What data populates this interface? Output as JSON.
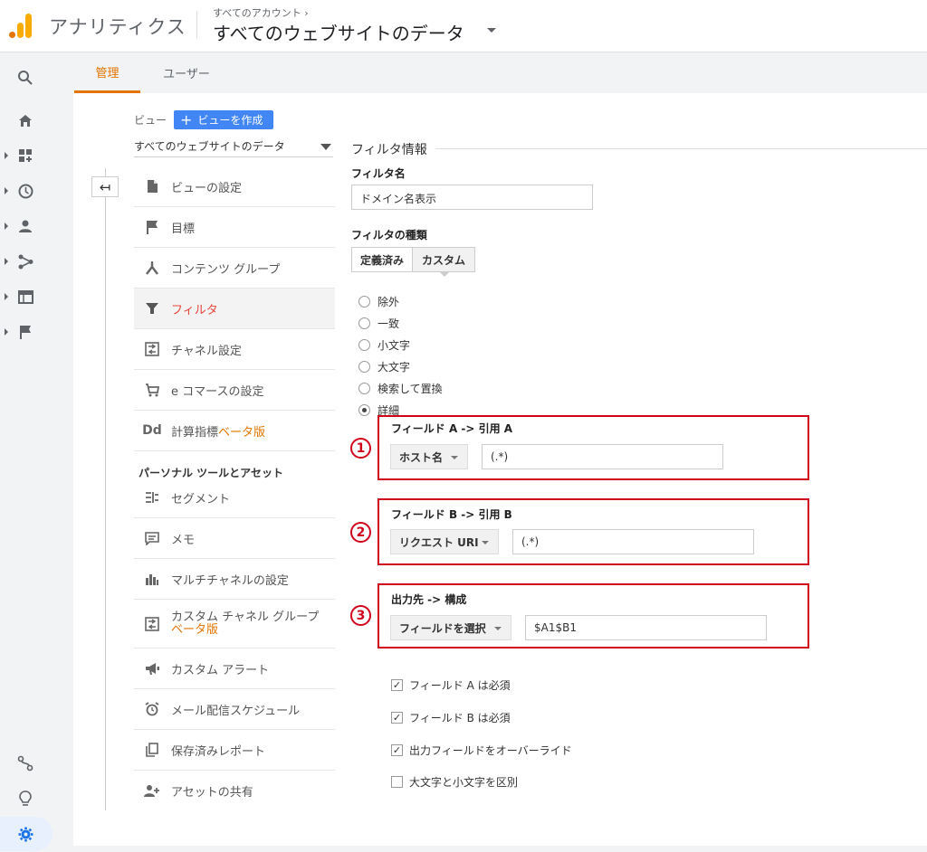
{
  "header": {
    "app_title": "アナリティクス",
    "account_crumb": "すべてのアカウント ›",
    "account_title": "すべてのウェブサイトのデータ"
  },
  "tabs": {
    "admin": "管理",
    "user": "ユーザー"
  },
  "view": {
    "label": "ビュー",
    "create_button": "ビューを作成",
    "selected": "すべてのウェブサイトのデータ"
  },
  "nav": {
    "items": [
      {
        "label": "ビューの設定",
        "icon": "document-icon"
      },
      {
        "label": "目標",
        "icon": "flag-icon"
      },
      {
        "label": "コンテンツ グループ",
        "icon": "content-group-icon"
      },
      {
        "label": "フィルタ",
        "icon": "filter-icon"
      },
      {
        "label": "チャネル設定",
        "icon": "channel-icon"
      },
      {
        "label": "e コマースの設定",
        "icon": "cart-icon"
      },
      {
        "label": "計算指標",
        "beta": "ベータ版",
        "icon_text": "Dd"
      }
    ],
    "section_title": "パーソナル ツールとアセット",
    "personal_items": [
      {
        "label": "セグメント",
        "icon": "segment-icon"
      },
      {
        "label": "メモ",
        "icon": "note-icon"
      },
      {
        "label": "マルチチャネルの設定",
        "icon": "bar-chart-icon"
      },
      {
        "label": "カスタム チャネル グループ",
        "beta": "ベータ版",
        "icon": "channel-icon"
      },
      {
        "label": "カスタム アラート",
        "icon": "megaphone-icon"
      },
      {
        "label": "メール配信スケジュール",
        "icon": "alarm-clock-icon"
      },
      {
        "label": "保存済みレポート",
        "icon": "copy-icon"
      },
      {
        "label": "アセットの共有",
        "icon": "add-person-icon"
      }
    ]
  },
  "filter": {
    "section_title": "フィルタ情報",
    "name_label": "フィルタ名",
    "name_value": "ドメイン名表示",
    "type_label": "フィルタの種類",
    "type_predefined": "定義済み",
    "type_custom": "カスタム",
    "radios": [
      "除外",
      "一致",
      "小文字",
      "大文字",
      "検索して置換",
      "詳細"
    ],
    "selected_radio": "詳細",
    "field_a": {
      "num": "1",
      "label": "フィールド A -> 引用 A",
      "select": "ホスト名",
      "value": "(.*)"
    },
    "field_b": {
      "num": "2",
      "label": "フィールド B -> 引用 B",
      "select": "リクエスト URI",
      "value": "(.*)"
    },
    "output": {
      "num": "3",
      "label": "出力先 -> 構成",
      "select": "フィールドを選択",
      "value": "$A1$B1"
    },
    "checks": [
      {
        "label": "フィールド A は必須",
        "checked": true
      },
      {
        "label": "フィールド B は必須",
        "checked": true
      },
      {
        "label": "出力フィールドをオーバーライド",
        "checked": true
      },
      {
        "label": "大文字と小文字を区別",
        "checked": false
      }
    ]
  },
  "colors": {
    "accent": "#e37400",
    "active_nav": "#e8453c",
    "highlight": "#d0021b",
    "primary": "#4285f4"
  }
}
